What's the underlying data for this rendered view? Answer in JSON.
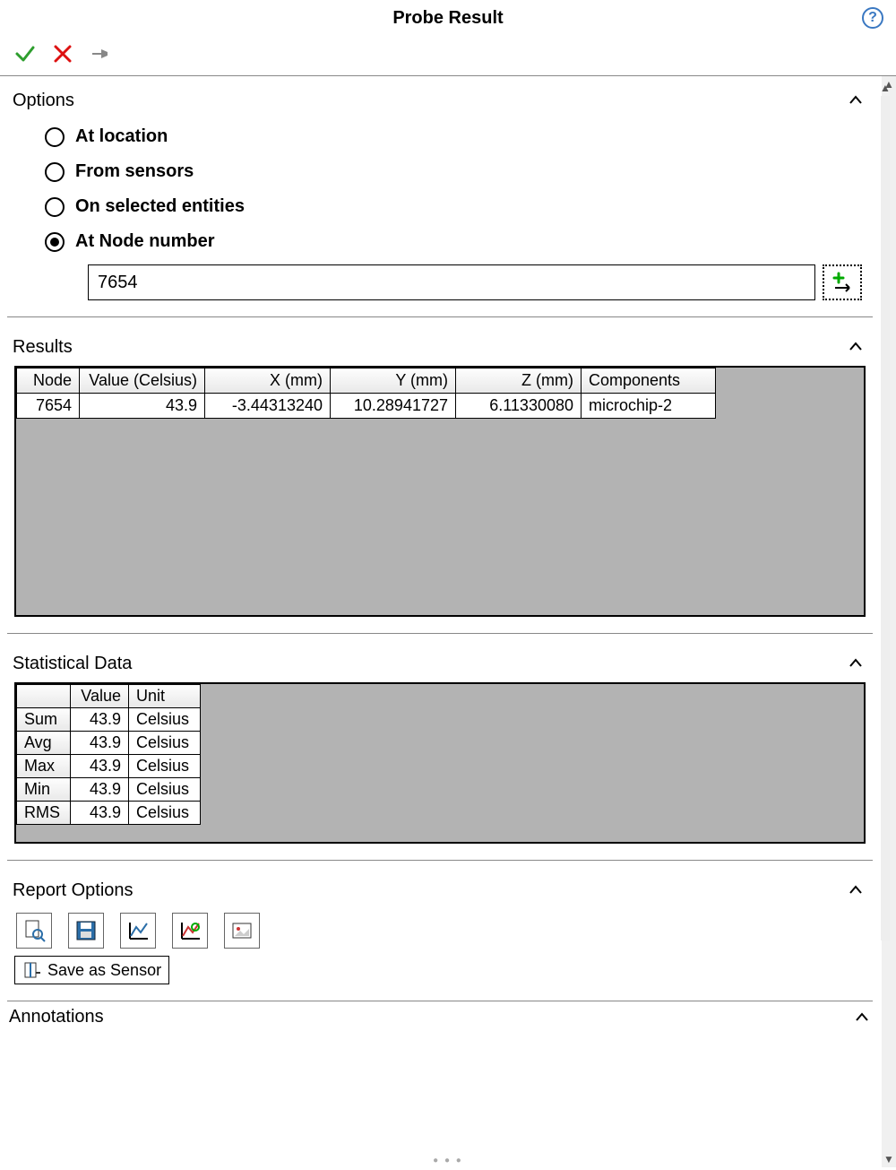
{
  "window": {
    "title": "Probe Result"
  },
  "sections": {
    "options": "Options",
    "results": "Results",
    "stats": "Statistical Data",
    "report": "Report Options",
    "annotations": "Annotations"
  },
  "options": {
    "radios": {
      "at_location": "At location",
      "from_sensors": "From sensors",
      "on_selected_entities": "On selected entities",
      "at_node_number": "At Node number"
    },
    "selected": "at_node_number",
    "node_input_value": "7654"
  },
  "results": {
    "headers": {
      "node": "Node",
      "value": "Value (Celsius)",
      "x": "X (mm)",
      "y": "Y (mm)",
      "z": "Z (mm)",
      "components": "Components"
    },
    "rows": [
      {
        "node": "7654",
        "value": "43.9",
        "x": "-3.44313240",
        "y": "10.28941727",
        "z": "6.11330080",
        "components": "microchip-2"
      }
    ]
  },
  "stats": {
    "headers": {
      "blank": "",
      "value": "Value",
      "unit": "Unit"
    },
    "rows": [
      {
        "label": "Sum",
        "value": "43.9",
        "unit": "Celsius"
      },
      {
        "label": "Avg",
        "value": "43.9",
        "unit": "Celsius"
      },
      {
        "label": "Max",
        "value": "43.9",
        "unit": "Celsius"
      },
      {
        "label": "Min",
        "value": "43.9",
        "unit": "Celsius"
      },
      {
        "label": "RMS",
        "value": "43.9",
        "unit": "Celsius"
      }
    ]
  },
  "report_tooltip": "Save as Sensor"
}
